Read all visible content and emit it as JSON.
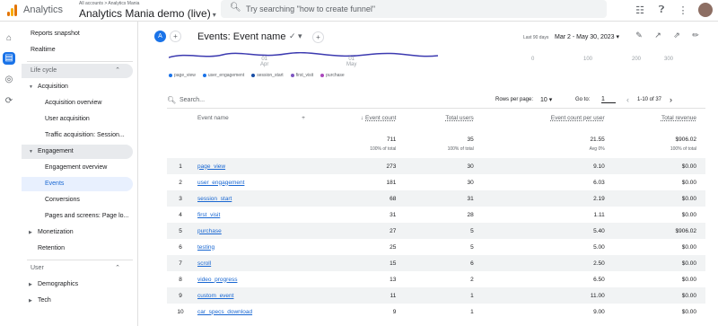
{
  "topbar": {
    "brand": "Analytics",
    "account_crumb": "All accounts > Analytics Mania",
    "account_name": "Analytics Mania demo (live)",
    "account_caret": "▾",
    "search_placeholder": "Try searching \"how to create funnel\""
  },
  "sidebar": {
    "items": [
      {
        "label": "Reports snapshot"
      },
      {
        "label": "Realtime"
      },
      {
        "label": "Life cycle"
      },
      {
        "label": "Acquisition"
      },
      {
        "label": "Acquisition overview"
      },
      {
        "label": "User acquisition"
      },
      {
        "label": "Traffic acquisition: Session..."
      },
      {
        "label": "Engagement"
      },
      {
        "label": "Engagement overview"
      },
      {
        "label": "Events"
      },
      {
        "label": "Conversions"
      },
      {
        "label": "Pages and screens: Page lo..."
      },
      {
        "label": "Monetization"
      },
      {
        "label": "Retention"
      },
      {
        "label": "User"
      },
      {
        "label": "Demographics"
      },
      {
        "label": "Tech"
      }
    ]
  },
  "report": {
    "badge": "A",
    "title": "Events: Event name",
    "date_label": "Last 90 days",
    "date_range": "Mar 2 - May 30, 2023 ▾"
  },
  "chart_strip": {
    "date_ticks": [
      [
        "01",
        "Apr"
      ],
      [
        "01",
        "May"
      ]
    ],
    "value_ticks": [
      "0",
      "100",
      "200",
      "300"
    ],
    "legend": [
      {
        "label": "page_view",
        "color": "#1a73e8"
      },
      {
        "label": "user_engagement",
        "color": "#1a73e8"
      },
      {
        "label": "session_start",
        "color": "#174ea6"
      },
      {
        "label": "first_visit",
        "color": "#7e57c2"
      },
      {
        "label": "purchase",
        "color": "#ab47bc"
      }
    ]
  },
  "table_controls": {
    "search_placeholder": "Search...",
    "rows_per_page_label": "Rows per page:",
    "rows_per_page_value": "10",
    "goto_label": "Go to:",
    "goto_value": "1",
    "page_info": "1-10 of 37"
  },
  "table": {
    "headers": {
      "event_name": "Event name",
      "event_count": "Event count",
      "total_users": "Total users",
      "event_count_per_user": "Event count per user",
      "total_revenue": "Total revenue"
    },
    "totals": {
      "event_count": "711",
      "event_count_sub": "100% of total",
      "total_users": "35",
      "total_users_sub": "100% of total",
      "per_user": "21.55",
      "per_user_sub": "Avg 0%",
      "revenue": "$906.02",
      "revenue_sub": "100% of total"
    },
    "rows": [
      {
        "n": "1",
        "name": "page_view",
        "count": "273",
        "users": "30",
        "per_user": "9.10",
        "revenue": "$0.00"
      },
      {
        "n": "2",
        "name": "user_engagement",
        "count": "181",
        "users": "30",
        "per_user": "6.03",
        "revenue": "$0.00"
      },
      {
        "n": "3",
        "name": "session_start",
        "count": "68",
        "users": "31",
        "per_user": "2.19",
        "revenue": "$0.00"
      },
      {
        "n": "4",
        "name": "first_visit",
        "count": "31",
        "users": "28",
        "per_user": "1.11",
        "revenue": "$0.00"
      },
      {
        "n": "5",
        "name": "purchase",
        "count": "27",
        "users": "5",
        "per_user": "5.40",
        "revenue": "$906.02"
      },
      {
        "n": "6",
        "name": "testing",
        "count": "25",
        "users": "5",
        "per_user": "5.00",
        "revenue": "$0.00"
      },
      {
        "n": "7",
        "name": "scroll",
        "count": "15",
        "users": "6",
        "per_user": "2.50",
        "revenue": "$0.00"
      },
      {
        "n": "8",
        "name": "video_progress",
        "count": "13",
        "users": "2",
        "per_user": "6.50",
        "revenue": "$0.00"
      },
      {
        "n": "9",
        "name": "custom_event",
        "count": "11",
        "users": "1",
        "per_user": "11.00",
        "revenue": "$0.00"
      },
      {
        "n": "10",
        "name": "car_specs_download",
        "count": "9",
        "users": "1",
        "per_user": "9.00",
        "revenue": "$0.00"
      }
    ]
  }
}
